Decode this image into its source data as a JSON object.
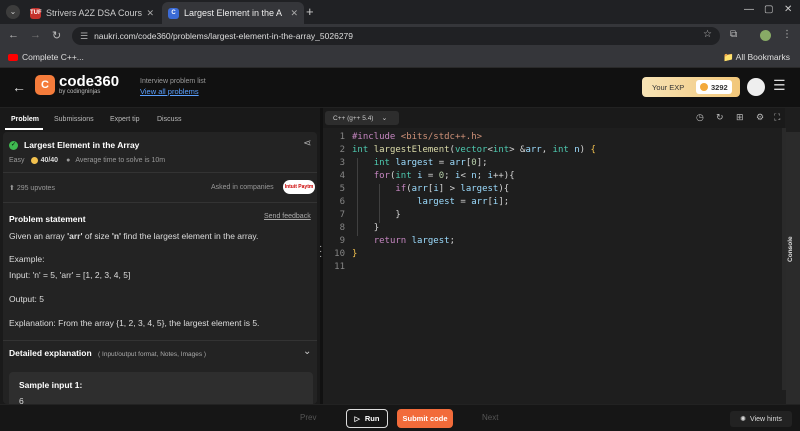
{
  "browser": {
    "tabs": [
      {
        "title": "Strivers A2Z DSA Course...",
        "favicon": "TUF",
        "color": "#c4302b"
      },
      {
        "title": "Largest Element in the A",
        "favicon": "C",
        "color": "#3b6bd6"
      }
    ],
    "url": "naukri.com/code360/problems/largest-element-in-the-array_5026279",
    "bookmark": "Complete C++...",
    "all_bookmarks": "All Bookmarks"
  },
  "header": {
    "logo_main": "code360",
    "logo_sub": "by codingninjas",
    "list_label": "Interview problem list",
    "list_link": "View all problems",
    "exp_label": "Your EXP",
    "exp_value": "3292"
  },
  "left_tabs": [
    "Problem",
    "Submissions",
    "Expert tip",
    "Discuss"
  ],
  "problem": {
    "title": "Largest Element in the Array",
    "difficulty": "Easy",
    "score": "40/40",
    "avg_time": "Average time to solve is 10m",
    "upvotes": "295 upvotes",
    "asked_in": "Asked in companies",
    "company": "Intuit Paytm",
    "statement_heading": "Problem statement",
    "send_feedback": "Send feedback",
    "statement_pre": "Given an array ",
    "arr_term": "'arr'",
    "statement_mid": " of size ",
    "n_term": "'n'",
    "statement_post": " find the largest element in the array.",
    "example_label": "Example:",
    "example_input": "Input: 'n' = 5, 'arr' = [1, 2, 3, 4, 5]",
    "example_output": "Output: 5",
    "example_explanation": "Explanation: From the array {1, 2, 3, 4, 5}, the largest element is 5.",
    "detailed_heading": "Detailed explanation",
    "detailed_sub": "( Input/output format, Notes, Images )",
    "sample_heading": "Sample input 1:",
    "sample_value": "6"
  },
  "editor": {
    "language": "C++ (g++ 5.4)",
    "line_numbers": [
      "1",
      "2",
      "3",
      "4",
      "5",
      "6",
      "7",
      "8",
      "9",
      "10",
      "11"
    ],
    "console_label": "Console"
  },
  "bottom": {
    "prev": "Prev",
    "run": "Run",
    "submit": "Submit code",
    "next": "Next",
    "hints": "View hints"
  }
}
